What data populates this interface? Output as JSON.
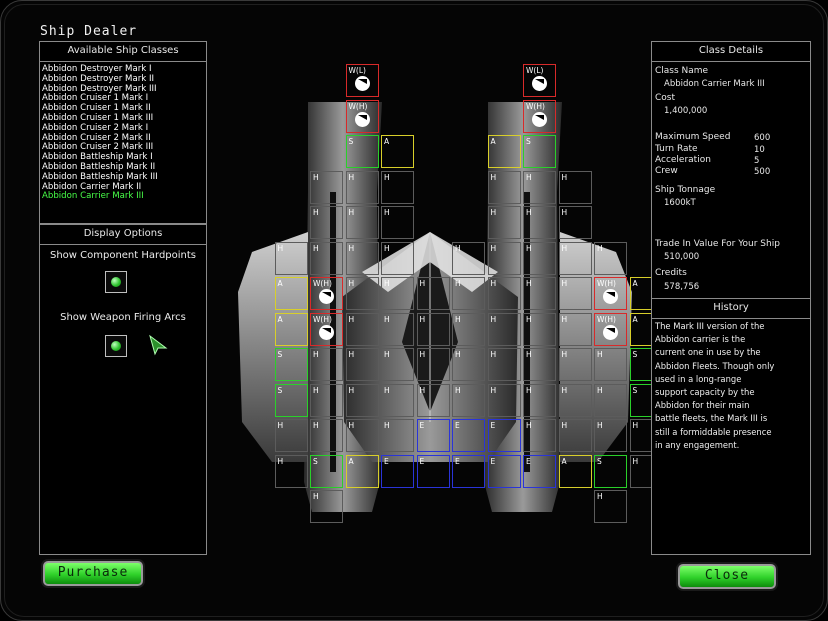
{
  "window": {
    "title": "Ship Dealer"
  },
  "left_panel": {
    "header": "Available Ship Classes",
    "items": [
      "Abbidon Destroyer Mark I",
      "Abbidon Destroyer Mark II",
      "Abbidon Destroyer Mark III",
      "Abbidon Cruiser 1 Mark I",
      "Abbidon Cruiser 1 Mark II",
      "Abbidon Cruiser 1 Mark III",
      "Abbidon Cruiser 2 Mark I",
      "Abbidon Cruiser 2 Mark II",
      "Abbidon Cruiser 2 Mark III",
      "Abbidon Battleship Mark I",
      "Abbidon Battleship Mark II",
      "Abbidon Battleship Mark III",
      "Abbidon Carrier Mark II",
      "Abbidon Carrier Mark III"
    ],
    "selected_index": 13
  },
  "display_options": {
    "header": "Display Options",
    "show_hardpoints": {
      "label": "Show Component Hardpoints",
      "checked": true
    },
    "show_arcs": {
      "label": "Show Weapon Firing Arcs",
      "checked": true
    }
  },
  "details": {
    "header": "Class Details",
    "class_name_label": "Class Name",
    "class_name": "Abbidon Carrier Mark III",
    "cost_label": "Cost",
    "cost": "1,400,000",
    "stats": [
      {
        "label": "Maximum Speed",
        "value": "600"
      },
      {
        "label": "Turn Rate",
        "value": "10"
      },
      {
        "label": "Acceleration",
        "value": "5"
      },
      {
        "label": "Crew",
        "value": "500"
      }
    ],
    "tonnage_label": "Ship Tonnage",
    "tonnage": "1600kT",
    "tradein_label": "Trade In Value For Your Ship",
    "tradein": "510,000",
    "credits_label": "Credits",
    "credits": "578,756",
    "history_header": "History",
    "history": "The Mark III version of the Abbidon carrier is the current one in use by the Abbidon Fleets. Though only used in a long-range support capacity by the Abbidon for their main battle fleets, the Mark III is still a formiddable presence in any engagement."
  },
  "buttons": {
    "purchase": "Purchase",
    "close": "Close"
  },
  "hardpoints": [
    {
      "t": "W(L)",
      "icon": true,
      "gx": 3,
      "gy": 0
    },
    {
      "t": "W(H)",
      "icon": true,
      "gx": 3,
      "gy": 1
    },
    {
      "t": "W(L)",
      "icon": true,
      "gx": 8,
      "gy": 0
    },
    {
      "t": "W(H)",
      "icon": true,
      "gx": 8,
      "gy": 1
    },
    {
      "t": "S",
      "gx": 3,
      "gy": 2
    },
    {
      "t": "A",
      "gx": 4,
      "gy": 2
    },
    {
      "t": "A",
      "gx": 7,
      "gy": 2
    },
    {
      "t": "S",
      "gx": 8,
      "gy": 2
    },
    {
      "t": "H",
      "gx": 2,
      "gy": 3
    },
    {
      "t": "H",
      "gx": 3,
      "gy": 3
    },
    {
      "t": "H",
      "gx": 4,
      "gy": 3
    },
    {
      "t": "H",
      "gx": 7,
      "gy": 3
    },
    {
      "t": "H",
      "gx": 8,
      "gy": 3
    },
    {
      "t": "H",
      "gx": 9,
      "gy": 3
    },
    {
      "t": "H",
      "gx": 2,
      "gy": 4
    },
    {
      "t": "H",
      "gx": 3,
      "gy": 4
    },
    {
      "t": "H",
      "gx": 4,
      "gy": 4
    },
    {
      "t": "H",
      "gx": 7,
      "gy": 4
    },
    {
      "t": "H",
      "gx": 8,
      "gy": 4
    },
    {
      "t": "H",
      "gx": 9,
      "gy": 4
    },
    {
      "t": "H",
      "gx": 1,
      "gy": 5
    },
    {
      "t": "H",
      "gx": 2,
      "gy": 5
    },
    {
      "t": "H",
      "gx": 3,
      "gy": 5
    },
    {
      "t": "H",
      "gx": 4,
      "gy": 5
    },
    {
      "t": "H",
      "gx": 6,
      "gy": 5
    },
    {
      "t": "H",
      "gx": 7,
      "gy": 5
    },
    {
      "t": "H",
      "gx": 8,
      "gy": 5
    },
    {
      "t": "H",
      "gx": 9,
      "gy": 5
    },
    {
      "t": "H",
      "gx": 10,
      "gy": 5
    },
    {
      "t": "A",
      "gx": 1,
      "gy": 6
    },
    {
      "t": "W(H)",
      "icon": true,
      "gx": 2,
      "gy": 6
    },
    {
      "t": "H",
      "gx": 3,
      "gy": 6
    },
    {
      "t": "H",
      "gx": 4,
      "gy": 6
    },
    {
      "t": "H",
      "gx": 5,
      "gy": 6
    },
    {
      "t": "H",
      "gx": 6,
      "gy": 6
    },
    {
      "t": "H",
      "gx": 7,
      "gy": 6
    },
    {
      "t": "H",
      "gx": 8,
      "gy": 6
    },
    {
      "t": "H",
      "gx": 9,
      "gy": 6
    },
    {
      "t": "W(H)",
      "icon": true,
      "gx": 10,
      "gy": 6
    },
    {
      "t": "A",
      "gx": 11,
      "gy": 6
    },
    {
      "t": "A",
      "gx": 1,
      "gy": 7
    },
    {
      "t": "W(H)",
      "icon": true,
      "gx": 2,
      "gy": 7
    },
    {
      "t": "H",
      "gx": 3,
      "gy": 7
    },
    {
      "t": "H",
      "gx": 4,
      "gy": 7
    },
    {
      "t": "H",
      "gx": 5,
      "gy": 7
    },
    {
      "t": "H",
      "gx": 6,
      "gy": 7
    },
    {
      "t": "H",
      "gx": 7,
      "gy": 7
    },
    {
      "t": "H",
      "gx": 8,
      "gy": 7
    },
    {
      "t": "H",
      "gx": 9,
      "gy": 7
    },
    {
      "t": "W(H)",
      "icon": true,
      "gx": 10,
      "gy": 7
    },
    {
      "t": "A",
      "gx": 11,
      "gy": 7
    },
    {
      "t": "S",
      "gx": 1,
      "gy": 8
    },
    {
      "t": "H",
      "gx": 2,
      "gy": 8
    },
    {
      "t": "H",
      "gx": 3,
      "gy": 8
    },
    {
      "t": "H",
      "gx": 4,
      "gy": 8
    },
    {
      "t": "H",
      "gx": 5,
      "gy": 8
    },
    {
      "t": "H",
      "gx": 6,
      "gy": 8
    },
    {
      "t": "H",
      "gx": 7,
      "gy": 8
    },
    {
      "t": "H",
      "gx": 8,
      "gy": 8
    },
    {
      "t": "H",
      "gx": 9,
      "gy": 8
    },
    {
      "t": "H",
      "gx": 10,
      "gy": 8
    },
    {
      "t": "S",
      "gx": 11,
      "gy": 8
    },
    {
      "t": "S",
      "gx": 1,
      "gy": 9
    },
    {
      "t": "H",
      "gx": 2,
      "gy": 9
    },
    {
      "t": "H",
      "gx": 3,
      "gy": 9
    },
    {
      "t": "H",
      "gx": 4,
      "gy": 9
    },
    {
      "t": "H",
      "gx": 5,
      "gy": 9
    },
    {
      "t": "H",
      "gx": 6,
      "gy": 9
    },
    {
      "t": "H",
      "gx": 7,
      "gy": 9
    },
    {
      "t": "H",
      "gx": 8,
      "gy": 9
    },
    {
      "t": "H",
      "gx": 9,
      "gy": 9
    },
    {
      "t": "H",
      "gx": 10,
      "gy": 9
    },
    {
      "t": "S",
      "gx": 11,
      "gy": 9
    },
    {
      "t": "H",
      "gx": 1,
      "gy": 10
    },
    {
      "t": "H",
      "gx": 2,
      "gy": 10
    },
    {
      "t": "H",
      "gx": 3,
      "gy": 10
    },
    {
      "t": "H",
      "gx": 4,
      "gy": 10
    },
    {
      "t": "E",
      "gx": 5,
      "gy": 10
    },
    {
      "t": "E",
      "gx": 6,
      "gy": 10
    },
    {
      "t": "E",
      "gx": 7,
      "gy": 10
    },
    {
      "t": "H",
      "gx": 8,
      "gy": 10
    },
    {
      "t": "H",
      "gx": 9,
      "gy": 10
    },
    {
      "t": "H",
      "gx": 10,
      "gy": 10
    },
    {
      "t": "H",
      "gx": 11,
      "gy": 10
    },
    {
      "t": "H",
      "gx": 1,
      "gy": 11
    },
    {
      "t": "S",
      "gx": 2,
      "gy": 11
    },
    {
      "t": "A",
      "gx": 3,
      "gy": 11
    },
    {
      "t": "E",
      "gx": 4,
      "gy": 11
    },
    {
      "t": "E",
      "gx": 5,
      "gy": 11
    },
    {
      "t": "E",
      "gx": 6,
      "gy": 11
    },
    {
      "t": "E",
      "gx": 7,
      "gy": 11
    },
    {
      "t": "E",
      "gx": 8,
      "gy": 11
    },
    {
      "t": "A",
      "gx": 9,
      "gy": 11
    },
    {
      "t": "S",
      "gx": 10,
      "gy": 11
    },
    {
      "t": "H",
      "gx": 11,
      "gy": 11
    },
    {
      "t": "H",
      "gx": 2,
      "gy": 12
    },
    {
      "t": "H",
      "gx": 10,
      "gy": 12
    }
  ]
}
